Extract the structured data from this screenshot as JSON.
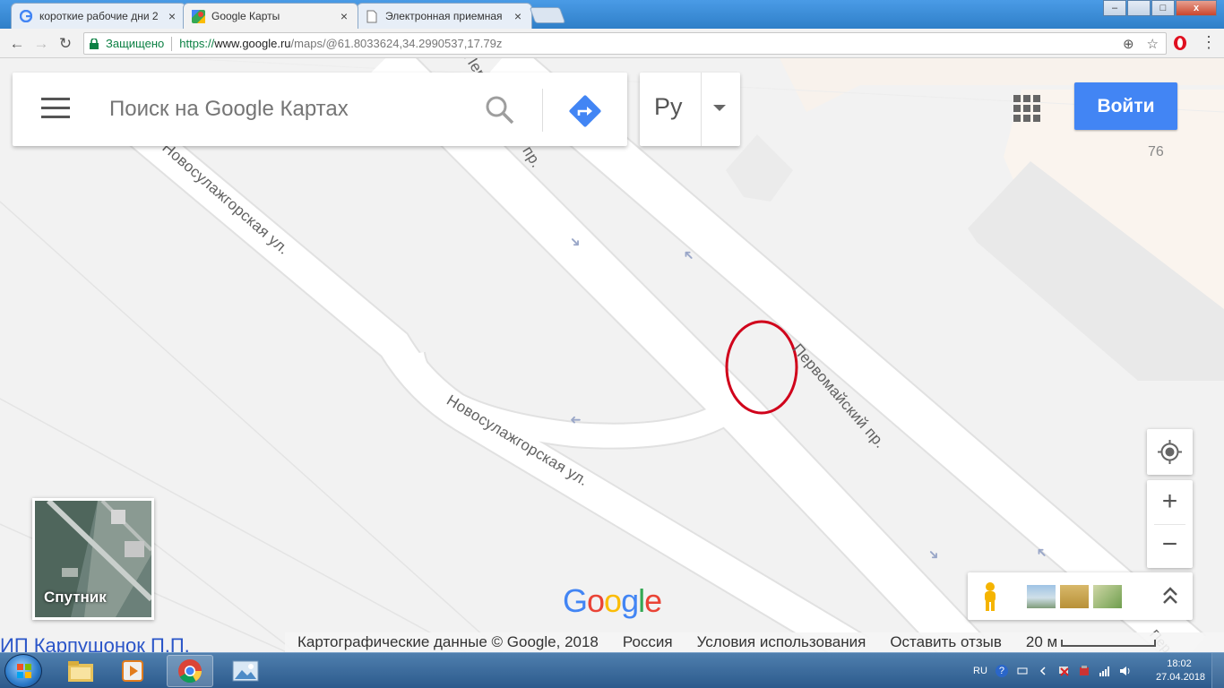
{
  "browser": {
    "tabs": [
      {
        "title": "короткие рабочие дни 2",
        "icon": "google-g-icon"
      },
      {
        "title": "Google Карты",
        "icon": "google-maps-icon"
      },
      {
        "title": "Электронная приемная",
        "icon": "document-icon"
      }
    ],
    "active_tab": 1,
    "tab_close_glyph": "×",
    "window_controls": {
      "minimize": "–",
      "maximize": "□",
      "close": "x"
    },
    "nav": {
      "back": "←",
      "forward": "→",
      "reload": "↻"
    },
    "address": {
      "secure_label": "Защищено",
      "url_scheme": "https://",
      "url_host": "www.google.ru",
      "url_path": "/maps/@61.8033624,34.2990537,17.79z"
    },
    "omnibox_icons": {
      "zoom": "⊕",
      "bookmark": "☆"
    },
    "menu_glyph": "⋮"
  },
  "maps": {
    "search_placeholder": "Поиск на Google Картах",
    "language_label": "Ру",
    "sign_in_label": "Войти",
    "building_number": "76",
    "zoom_in_label": "+",
    "zoom_out_label": "−",
    "expand_glyph": "⌃",
    "satellite_label": "Спутник",
    "streets": {
      "novosulazhgorskaya_upper": "Новосулажгорская ул.",
      "novosulazhgorskaya_lower": "Новосулажгорская ул.",
      "pervomaisky_main": "Первомайский пр.",
      "pervomaisky_top": "Первомайский пр.",
      "pervomaisky_corner": "Пер"
    },
    "google_logo_letters": [
      "G",
      "o",
      "o",
      "g",
      "l",
      "e"
    ],
    "google_logo_colors": [
      "#4285f4",
      "#ea4335",
      "#fbbc05",
      "#4285f4",
      "#34a853",
      "#ea4335"
    ],
    "footer": {
      "map_data": "Картографические данные © Google, 2018",
      "region": "Россия",
      "terms": "Условия использования",
      "feedback": "Оставить отзыв",
      "scale": "20 м"
    },
    "overlay_text": "ИП Карпушонок П.П.",
    "annotation_color": "#d0021b"
  },
  "taskbar": {
    "apps": [
      "windows-explorer-icon",
      "media-player-icon",
      "chrome-icon",
      "photo-viewer-icon"
    ],
    "active_app": "chrome-icon",
    "tray": {
      "language": "RU",
      "help_glyph": "?"
    },
    "time": "18:02",
    "date": "27.04.2018"
  },
  "colors": {
    "accent": "#4285f4",
    "road": "#ffffff",
    "map_background": "#f2f2f2",
    "arrow": "#9aa7c8"
  }
}
